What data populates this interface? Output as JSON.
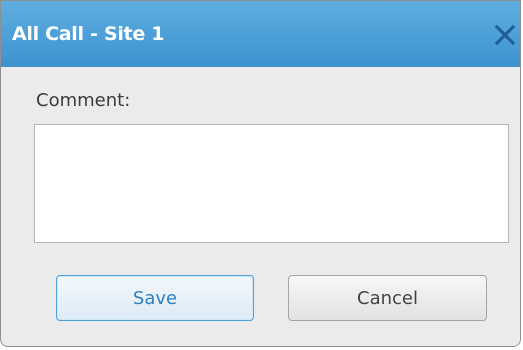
{
  "dialog": {
    "title": "All Call - Site 1",
    "close_icon": "close-icon"
  },
  "form": {
    "comment_label": "Comment:",
    "comment_value": "",
    "comment_placeholder": ""
  },
  "buttons": {
    "save_label": "Save",
    "cancel_label": "Cancel"
  },
  "colors": {
    "titlebar": "#4a9fd8",
    "title_text": "#ffffff",
    "close_icon": "#1f5e96",
    "save_text": "#2f7fc1",
    "background": "#ebebeb"
  }
}
